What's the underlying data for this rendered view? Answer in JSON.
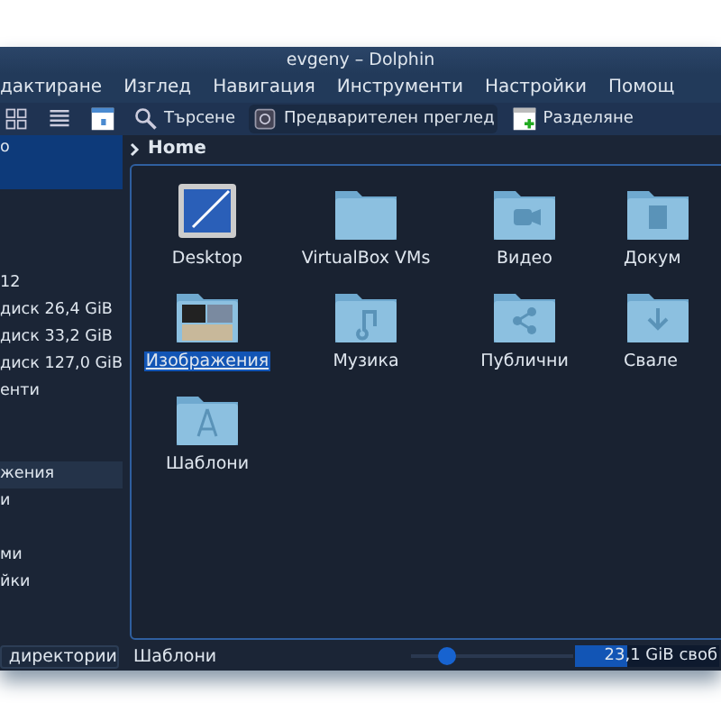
{
  "window": {
    "title": "evgeny – Dolphin"
  },
  "menu": [
    "дактиране",
    "Изглед",
    "Навигация",
    "Инструменти",
    "Настройки",
    "Помощ"
  ],
  "toolbar": [
    {
      "kind": "icons-view"
    },
    {
      "kind": "details-view"
    },
    {
      "kind": "columns-view"
    },
    {
      "kind": "search",
      "label": "Търсене"
    },
    {
      "kind": "preview",
      "label": "Предварителен преглед"
    },
    {
      "kind": "split",
      "label": "Разделяне"
    }
  ],
  "breadcrumb": "Home",
  "sidebar": {
    "items": [
      {
        "label": "о",
        "selected": true,
        "hover": false
      },
      {
        "label": "12",
        "selected": false
      },
      {
        "label": "диск 26,4 GiB",
        "selected": false
      },
      {
        "label": "диск 33,2 GiB",
        "selected": false
      },
      {
        "label": "диск 127,0 GiB",
        "selected": false
      },
      {
        "label": "енти",
        "selected": false
      },
      {
        "label": "жения",
        "selected": false,
        "hover": true
      },
      {
        "label": "и",
        "selected": false
      },
      {
        "label": "ми",
        "selected": false
      },
      {
        "label": "йки",
        "selected": false
      }
    ],
    "button": "директории"
  },
  "files": [
    {
      "name": "Desktop",
      "kind": "desktop",
      "selected": false
    },
    {
      "name": "VirtualBox VMs",
      "kind": "folder",
      "selected": false
    },
    {
      "name": "Видео",
      "kind": "video",
      "selected": false
    },
    {
      "name": "Докум",
      "kind": "document",
      "selected": false
    },
    {
      "name": "Изображения",
      "kind": "pictures",
      "selected": true
    },
    {
      "name": "Музика",
      "kind": "music",
      "selected": false
    },
    {
      "name": "Публични",
      "kind": "share",
      "selected": false
    },
    {
      "name": "Свале",
      "kind": "download",
      "selected": false
    },
    {
      "name": "Шаблони",
      "kind": "templates",
      "selected": false
    }
  ],
  "status_bar": {
    "text": "Шаблони",
    "zoom": {
      "level": 0.22
    },
    "space": {
      "text": "23,1 GiB своб",
      "level": 0.36
    }
  }
}
